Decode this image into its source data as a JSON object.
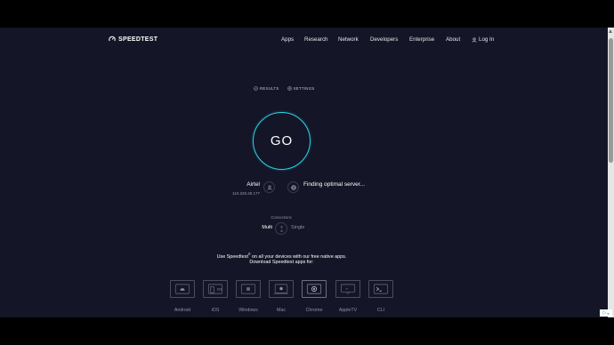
{
  "header": {
    "logo_text": "SPEEDTEST",
    "nav": [
      {
        "label": "Apps"
      },
      {
        "label": "Research"
      },
      {
        "label": "Network"
      },
      {
        "label": "Developers"
      },
      {
        "label": "Enterprise"
      },
      {
        "label": "About"
      }
    ],
    "login_label": "Log In"
  },
  "tabs": {
    "results": "RESULTS",
    "settings": "SETTINGS"
  },
  "go": {
    "label": "GO",
    "accent_color": "#2ad2e6"
  },
  "isp": {
    "name": "Airtel",
    "ip": "110.225.29.177"
  },
  "server": {
    "status": "Finding optimal server..."
  },
  "connections": {
    "label": "Connections",
    "multi": "Multi",
    "single": "Single"
  },
  "promo": {
    "line1_prefix": "Use Speedtest",
    "line1_sup": "®",
    "line1_suffix": " on all your devices with our free native apps.",
    "line2": "Download Speedtest apps for:"
  },
  "apps": [
    {
      "label": "Android",
      "icon": "android-icon"
    },
    {
      "label": "iOS",
      "icon": "ios-icon"
    },
    {
      "label": "Windows",
      "icon": "windows-icon"
    },
    {
      "label": "Mac",
      "icon": "mac-icon"
    },
    {
      "label": "Chrome",
      "icon": "chrome-icon"
    },
    {
      "label": "AppleTV",
      "icon": "appletv-icon"
    },
    {
      "label": "CLI",
      "icon": "cli-icon"
    }
  ],
  "colors": {
    "background": "#141526",
    "accent": "#2ad2e6"
  }
}
